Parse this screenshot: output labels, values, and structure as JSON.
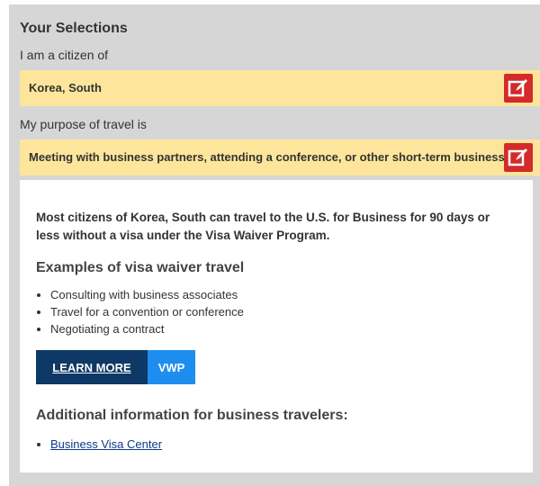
{
  "selections": {
    "title": "Your Selections",
    "citizen_label": "I am a citizen of",
    "citizen_value": "Korea, South",
    "purpose_label": "My purpose of travel is",
    "purpose_value": "Meeting with business partners, attending a conference, or other short-term business.",
    "edit_icon": "edit-icon",
    "edit_color": "#d42a2a",
    "bar_color": "#fde69b"
  },
  "result": {
    "intro": "Most citizens of Korea, South can travel to the U.S. for Business for 90 days or less without a visa under the Visa Waiver Program.",
    "examples_heading": "Examples of visa waiver travel",
    "examples": [
      "Consulting with business associates",
      "Travel for a convention or conference",
      "Negotiating a contract"
    ],
    "learn_more_label": "LEARN MORE",
    "vwp_label": "VWP",
    "additional_heading": "Additional information for business travelers:",
    "links": [
      "Business Visa Center"
    ],
    "button_color": "#0e3866",
    "tag_color": "#1e8df0"
  }
}
